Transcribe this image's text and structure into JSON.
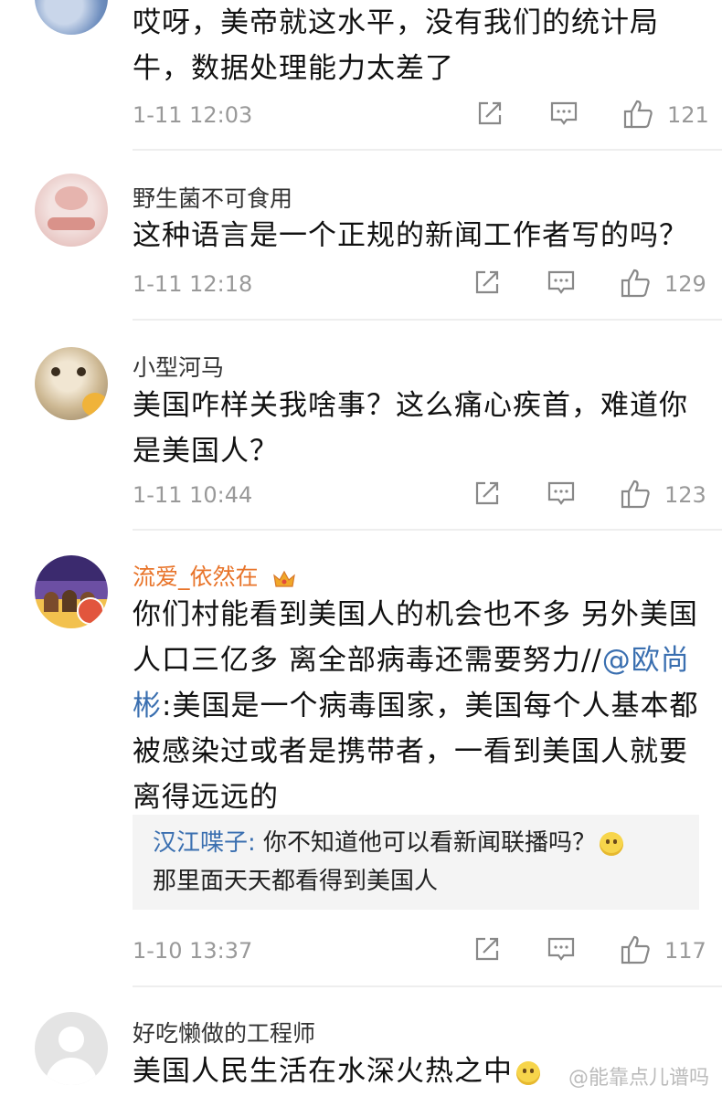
{
  "comments": [
    {
      "name": "",
      "text": "哎呀，美帝就这水平，没有我们的统计局牛，数据处理能力太差了",
      "time": "1-11 12:03",
      "likes": "121"
    },
    {
      "name": "野生菌不可食用",
      "text": "这种语言是一个正规的新闻工作者写的吗？",
      "time": "1-11 12:18",
      "likes": "129"
    },
    {
      "name": "小型河马",
      "text": "美国咋样关我啥事？这么痛心疾首，难道你是美国人？",
      "time": "1-11 10:44",
      "likes": "123"
    },
    {
      "name": "流爱_依然在",
      "text_before": "你们村能看到美国人的机会也不多 另外美国人口三亿多 离全部病毒还需要努力//",
      "mention": "@欧尚彬",
      "text_after": ":美国是一个病毒国家，美国每个人基本都被感染过或者是携带者，一看到美国人就要离得远远的",
      "reply_name": "汉江喋子:",
      "reply_text": "你不知道他可以看新闻联播吗？",
      "reply_text2": "那里面天天都看得到美国人",
      "time": "1-10 13:37",
      "likes": "117"
    },
    {
      "name": "好吃懒做的工程师",
      "text": "美国人民生活在水深火热之中"
    }
  ],
  "watermark": "@能靠点儿谱吗",
  "icons": {
    "share": "share-icon",
    "comment": "comment-icon",
    "like": "thumbs-up-icon",
    "vip": "crown-icon",
    "emoji": "smile-emoji-icon"
  },
  "colors": {
    "link": "#3a6fb0",
    "vip_name": "#e8742a",
    "meta": "#999999"
  }
}
